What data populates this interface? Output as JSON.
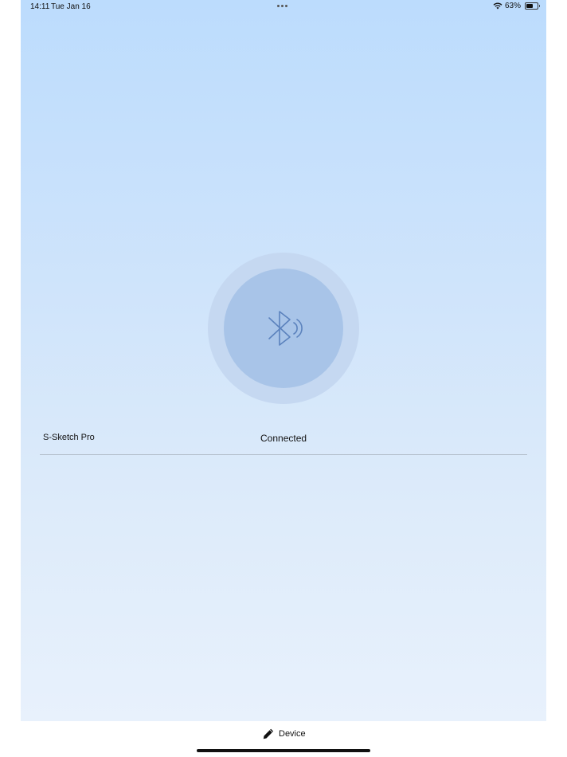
{
  "status_bar": {
    "time": "14:11",
    "date": "Tue Jan 16",
    "battery_percent": "63%",
    "battery_level": 0.63
  },
  "main": {
    "bluetooth_icon": "bluetooth-signal-icon",
    "device_name": "S-Sketch Pro",
    "device_status": "Connected"
  },
  "tab_bar": {
    "device_label": "Device",
    "device_icon": "pencil-icon"
  },
  "colors": {
    "background_top": "#bcdcfd",
    "background_bottom": "#e8f1fc",
    "circle_outer": "#c5d8f1",
    "circle_inner": "#a8c4e8",
    "icon_stroke": "#5b82bd"
  }
}
